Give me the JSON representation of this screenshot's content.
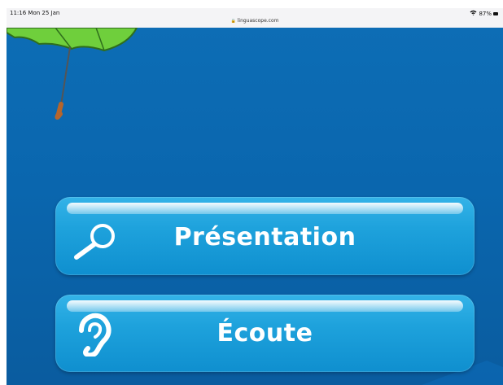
{
  "status_bar": {
    "time": "11:16  Mon 25 Jan",
    "url": "linguascope.com",
    "battery": "87%"
  },
  "menu": {
    "presentation_label": "Présentation",
    "ecoute_label": "Écoute"
  },
  "colors": {
    "background": "#0a66ae",
    "button": "#1ea2dc",
    "umbrella_canopy": "#6fcf3c",
    "umbrella_handle": "#b5652c"
  },
  "icons": {
    "presentation": "magnifier-icon",
    "ecoute": "ear-icon"
  }
}
